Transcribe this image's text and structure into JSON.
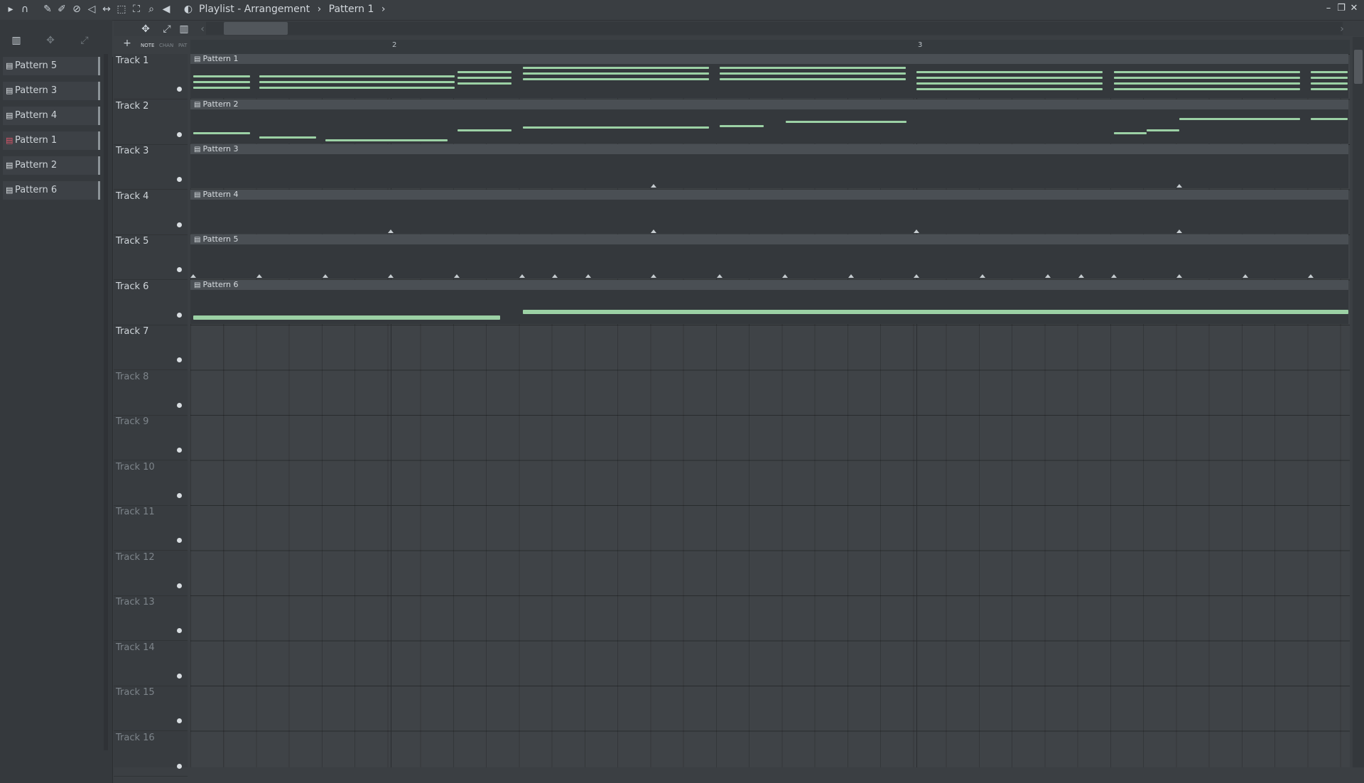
{
  "titlebar": {
    "crumb1": "Playlist - Arrangement",
    "crumb2": "Pattern 1",
    "sep": "›"
  },
  "toolbar": {
    "icons": [
      "arrow-right-icon",
      "magnet-icon",
      "pencil-icon",
      "paint-icon",
      "delete-icon",
      "mute-icon",
      "slip-icon",
      "select-icon",
      "zoom-sel-icon",
      "zoom-icon",
      "playback-icon",
      "playlist-icon"
    ],
    "sub_labels": [
      "NOTE",
      "CHAN",
      "PAT"
    ]
  },
  "picker": {
    "items": [
      {
        "label": "Pattern 5"
      },
      {
        "label": "Pattern 3"
      },
      {
        "label": "Pattern 4"
      },
      {
        "label": "Pattern 1",
        "selected": true
      },
      {
        "label": "Pattern 2"
      },
      {
        "label": "Pattern 6"
      }
    ]
  },
  "ruler": {
    "bars": [
      "2",
      "3"
    ]
  },
  "tracks": [
    {
      "name": "Track 1"
    },
    {
      "name": "Track 2"
    },
    {
      "name": "Track 3"
    },
    {
      "name": "Track 4"
    },
    {
      "name": "Track 5"
    },
    {
      "name": "Track 6"
    },
    {
      "name": "Track 7"
    },
    {
      "name": "Track 8"
    },
    {
      "name": "Track 9"
    },
    {
      "name": "Track 10"
    },
    {
      "name": "Track 11"
    },
    {
      "name": "Track 12"
    },
    {
      "name": "Track 13"
    },
    {
      "name": "Track 14"
    },
    {
      "name": "Track 15"
    },
    {
      "name": "Track 16"
    }
  ],
  "clips": [
    {
      "track": 1,
      "label": "Pattern 1"
    },
    {
      "track": 2,
      "label": "Pattern 2"
    },
    {
      "track": 3,
      "label": "Pattern 3"
    },
    {
      "track": 4,
      "label": "Pattern 4"
    },
    {
      "track": 5,
      "label": "Pattern 5"
    },
    {
      "track": 6,
      "label": "Pattern 6"
    }
  ],
  "colors": {
    "note": "#9cd1a5",
    "selected_icon": "#e0566b"
  }
}
